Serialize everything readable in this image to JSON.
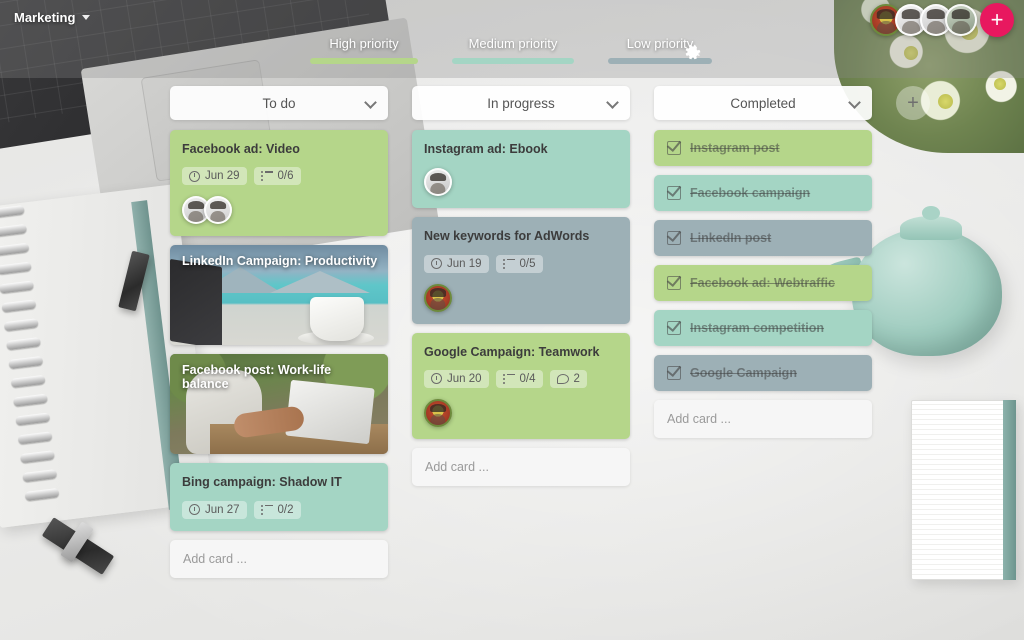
{
  "app": {
    "board_title": "Marketing",
    "title_chevron_icon": "chevron-down-icon",
    "settings_icon": "gear-icon"
  },
  "priority_filters": [
    {
      "label": "High priority",
      "color": "#b5d68a"
    },
    {
      "label": "Medium priority",
      "color": "#a4d5c4"
    },
    {
      "label": "Low priority",
      "color": "#9db0b6"
    }
  ],
  "members": {
    "avatars": [
      "avatar-1",
      "avatar-2",
      "avatar-3",
      "avatar-4"
    ],
    "add_member_label": "+",
    "add_member_color": "#e8185f"
  },
  "add_column_label": "+",
  "columns": [
    {
      "title": "To do",
      "chevron_icon": "chevron-down-icon",
      "add_card_placeholder": "Add card ...",
      "cards": [
        {
          "type": "text",
          "title": "Facebook ad: Video",
          "color": "#b5d68a",
          "due": "Jun 29",
          "checklist": "0/6",
          "avatars": 2
        },
        {
          "type": "image",
          "title": "LinkedIn Campaign: Productivity",
          "scene": "lake-laptop-coffee"
        },
        {
          "type": "image",
          "title": "Facebook post: Work-life balance",
          "scene": "outdoor-laptop-people"
        },
        {
          "type": "text",
          "title": "Bing campaign: Shadow IT",
          "color": "#a4d5c4",
          "due": "Jun 27",
          "checklist": "0/2",
          "avatars": 0
        }
      ]
    },
    {
      "title": "In progress",
      "chevron_icon": "chevron-down-icon",
      "add_card_placeholder": "Add card ...",
      "cards": [
        {
          "type": "text",
          "title": "Instagram ad: Ebook",
          "color": "#a4d5c4",
          "due": "",
          "checklist": "",
          "avatars": 1
        },
        {
          "type": "text",
          "title": "New keywords for AdWords",
          "color": "#9db0b6",
          "due": "Jun 19",
          "checklist": "0/5",
          "avatars": 1
        },
        {
          "type": "text",
          "title": "Google Campaign: Teamwork",
          "color": "#b5d68a",
          "due": "Jun 20",
          "checklist": "0/4",
          "comments": "2",
          "avatars": 1
        }
      ]
    },
    {
      "title": "Completed",
      "chevron_icon": "chevron-down-icon",
      "add_card_placeholder": "Add card ...",
      "cards": [
        {
          "type": "done",
          "title": "Instagram post",
          "color": "#b5d68a"
        },
        {
          "type": "done",
          "title": "Facebook campaign",
          "color": "#a4d5c4"
        },
        {
          "type": "done",
          "title": "LinkedIn post",
          "color": "#9db0b6"
        },
        {
          "type": "done",
          "title": "Facebook ad: Webtraffic",
          "color": "#b5d68a"
        },
        {
          "type": "done",
          "title": "Instagram competition",
          "color": "#a4d5c4"
        },
        {
          "type": "done",
          "title": "Google Campaign",
          "color": "#9db0b6"
        }
      ]
    }
  ]
}
